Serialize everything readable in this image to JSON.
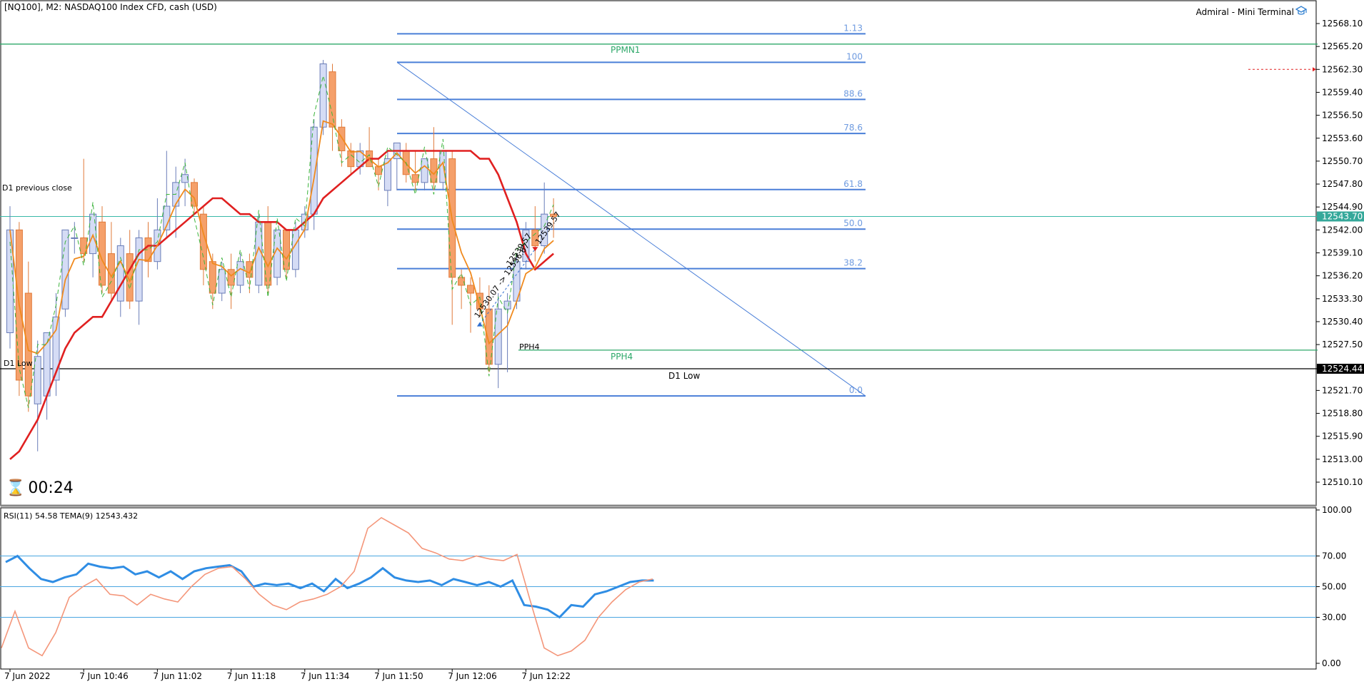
{
  "header": {
    "symbol_title": "[NQ100], M2:  NASDAQ100 Index CFD, cash (USD)",
    "terminal_label": "Admiral - Mini Terminal",
    "terminal_icon": "graduation-cap-icon"
  },
  "timer": {
    "icon": "hourglass-icon",
    "value": "00:24"
  },
  "colors": {
    "bull_fill": "#d5dcf5",
    "bull_border": "#6a7db8",
    "bear_fill": "#f5a06a",
    "bear_border": "#e07a3a",
    "fib_line": "#4a7fd8",
    "fib_text": "#6f9be0",
    "ppmn1": "#2ea86a",
    "pph4": "#2ea86a",
    "ma_red": "#e02020",
    "ma_orange": "#f08a1e",
    "ma_green_dashed": "#3cb43c",
    "bid_line": "#38b8a8",
    "bid_box": "#35a89a",
    "low_box": "#000000",
    "rsi_blue": "#2f8de4",
    "rsi_orange": "#f4967a",
    "rsi_level": "#4aa6e0",
    "grid_text": "#000000"
  },
  "chart_data": {
    "type": "candlestick",
    "price_axis": {
      "ylim": [
        12507.4,
        12570.0
      ],
      "ticks": [
        "12568.10",
        "12565.20",
        "12562.30",
        "12559.40",
        "12556.50",
        "12553.60",
        "12550.70",
        "12547.80",
        "12544.90",
        "12542.00",
        "12539.10",
        "12536.20",
        "12533.30",
        "12530.40",
        "12527.50",
        "12521.70",
        "12518.80",
        "12515.90",
        "12513.00",
        "12510.10"
      ],
      "tick_values": [
        12568.1,
        12565.2,
        12562.3,
        12559.4,
        12556.5,
        12553.6,
        12550.7,
        12547.8,
        12544.9,
        12542.0,
        12539.1,
        12536.2,
        12533.3,
        12530.4,
        12527.5,
        12521.7,
        12518.8,
        12515.9,
        12513.0,
        12510.1
      ],
      "current_price_label": "12543.70",
      "current_price": 12543.7,
      "low_price_label": "12524.44",
      "low_price": 12524.44
    },
    "time_axis": {
      "labels": [
        "7 Jun 2022",
        "7 Jun 10:46",
        "7 Jun 11:02",
        "7 Jun 11:18",
        "7 Jun 11:34",
        "7 Jun 11:50",
        "7 Jun 12:06",
        "7 Jun 12:22"
      ],
      "label_bar_index": [
        0,
        8,
        16,
        24,
        32,
        40,
        48,
        56
      ]
    },
    "candles": [
      {
        "o": 12529.0,
        "h": 12545.0,
        "l": 12527.0,
        "c": 12542.0
      },
      {
        "o": 12542.0,
        "h": 12543.0,
        "l": 12521.0,
        "c": 12523.0
      },
      {
        "o": 12534.0,
        "h": 12538.0,
        "l": 12519.0,
        "c": 12521.0
      },
      {
        "o": 12520.0,
        "h": 12528.0,
        "l": 12514.0,
        "c": 12526.0
      },
      {
        "o": 12521.0,
        "h": 12529.0,
        "l": 12518.0,
        "c": 12529.0
      },
      {
        "o": 12523.0,
        "h": 12534.0,
        "l": 12521.0,
        "c": 12531.0
      },
      {
        "o": 12532.0,
        "h": 12542.0,
        "l": 12531.0,
        "c": 12542.0
      },
      {
        "o": 12541.0,
        "h": 12543.0,
        "l": 12539.0,
        "c": 12541.0
      },
      {
        "o": 12541.0,
        "h": 12551.0,
        "l": 12538.0,
        "c": 12539.0
      },
      {
        "o": 12539.0,
        "h": 12544.0,
        "l": 12536.0,
        "c": 12544.0
      },
      {
        "o": 12543.0,
        "h": 12545.0,
        "l": 12534.0,
        "c": 12535.0
      },
      {
        "o": 12539.0,
        "h": 12543.0,
        "l": 12533.0,
        "c": 12534.0
      },
      {
        "o": 12533.0,
        "h": 12541.0,
        "l": 12531.0,
        "c": 12540.0
      },
      {
        "o": 12539.0,
        "h": 12542.0,
        "l": 12532.0,
        "c": 12533.0
      },
      {
        "o": 12533.0,
        "h": 12542.0,
        "l": 12530.0,
        "c": 12541.0
      },
      {
        "o": 12541.0,
        "h": 12543.0,
        "l": 12536.0,
        "c": 12538.0
      },
      {
        "o": 12538.0,
        "h": 12546.0,
        "l": 12537.0,
        "c": 12542.0
      },
      {
        "o": 12542.0,
        "h": 12552.0,
        "l": 12541.0,
        "c": 12545.0
      },
      {
        "o": 12545.0,
        "h": 12550.0,
        "l": 12541.0,
        "c": 12548.0
      },
      {
        "o": 12548.0,
        "h": 12551.0,
        "l": 12545.0,
        "c": 12549.0
      },
      {
        "o": 12548.0,
        "h": 12548.5,
        "l": 12544.0,
        "c": 12545.0
      },
      {
        "o": 12544.0,
        "h": 12545.0,
        "l": 12535.0,
        "c": 12537.0
      },
      {
        "o": 12538.0,
        "h": 12539.0,
        "l": 12532.0,
        "c": 12534.0
      },
      {
        "o": 12534.0,
        "h": 12538.0,
        "l": 12533.0,
        "c": 12537.0
      },
      {
        "o": 12537.0,
        "h": 12539.0,
        "l": 12532.0,
        "c": 12535.0
      },
      {
        "o": 12535.0,
        "h": 12539.0,
        "l": 12534.0,
        "c": 12538.0
      },
      {
        "o": 12538.0,
        "h": 12539.0,
        "l": 12534.0,
        "c": 12536.0
      },
      {
        "o": 12535.0,
        "h": 12544.0,
        "l": 12534.0,
        "c": 12543.0
      },
      {
        "o": 12543.0,
        "h": 12545.0,
        "l": 12534.0,
        "c": 12535.0
      },
      {
        "o": 12536.0,
        "h": 12542.0,
        "l": 12535.0,
        "c": 12542.0
      },
      {
        "o": 12542.0,
        "h": 12542.0,
        "l": 12536.0,
        "c": 12537.0
      },
      {
        "o": 12537.0,
        "h": 12543.0,
        "l": 12536.0,
        "c": 12542.0
      },
      {
        "o": 12542.0,
        "h": 12545.0,
        "l": 12541.0,
        "c": 12544.0
      },
      {
        "o": 12544.0,
        "h": 12556.0,
        "l": 12542.0,
        "c": 12555.0
      },
      {
        "o": 12555.0,
        "h": 12563.5,
        "l": 12554.0,
        "c": 12563.0
      },
      {
        "o": 12562.0,
        "h": 12563.0,
        "l": 12552.0,
        "c": 12555.0
      },
      {
        "o": 12555.0,
        "h": 12556.0,
        "l": 12550.0,
        "c": 12552.0
      },
      {
        "o": 12552.0,
        "h": 12553.0,
        "l": 12549.0,
        "c": 12550.0
      },
      {
        "o": 12550.0,
        "h": 12553.0,
        "l": 12549.0,
        "c": 12552.0
      },
      {
        "o": 12552.0,
        "h": 12555.0,
        "l": 12550.0,
        "c": 12550.0
      },
      {
        "o": 12550.0,
        "h": 12551.0,
        "l": 12547.0,
        "c": 12549.0
      },
      {
        "o": 12547.0,
        "h": 12552.0,
        "l": 12545.0,
        "c": 12551.0
      },
      {
        "o": 12551.0,
        "h": 12553.0,
        "l": 12547.0,
        "c": 12553.0
      },
      {
        "o": 12552.0,
        "h": 12553.0,
        "l": 12548.0,
        "c": 12549.0
      },
      {
        "o": 12549.0,
        "h": 12552.0,
        "l": 12547.0,
        "c": 12548.0
      },
      {
        "o": 12548.0,
        "h": 12551.0,
        "l": 12547.0,
        "c": 12551.0
      },
      {
        "o": 12551.0,
        "h": 12555.0,
        "l": 12547.0,
        "c": 12548.0
      },
      {
        "o": 12548.0,
        "h": 12552.0,
        "l": 12547.0,
        "c": 12552.0
      },
      {
        "o": 12551.0,
        "h": 12552.0,
        "l": 12530.0,
        "c": 12536.0
      },
      {
        "o": 12536.0,
        "h": 12537.0,
        "l": 12532.0,
        "c": 12535.0
      },
      {
        "o": 12535.0,
        "h": 12536.0,
        "l": 12529.0,
        "c": 12534.0
      },
      {
        "o": 12534.0,
        "h": 12536.0,
        "l": 12531.0,
        "c": 12532.0
      },
      {
        "o": 12532.0,
        "h": 12535.0,
        "l": 12524.0,
        "c": 12525.0
      },
      {
        "o": 12525.0,
        "h": 12534.0,
        "l": 12522.0,
        "c": 12532.0
      },
      {
        "o": 12532.0,
        "h": 12534.0,
        "l": 12524.0,
        "c": 12533.0
      },
      {
        "o": 12533.0,
        "h": 12539.0,
        "l": 12532.0,
        "c": 12538.0
      },
      {
        "o": 12538.0,
        "h": 12543.0,
        "l": 12537.0,
        "c": 12542.0
      },
      {
        "o": 12542.0,
        "h": 12545.0,
        "l": 12538.0,
        "c": 12540.0
      },
      {
        "o": 12540.0,
        "h": 12548.0,
        "l": 12539.0,
        "c": 12544.0
      },
      {
        "o": 12544.0,
        "h": 12546.0,
        "l": 12541.0,
        "c": 12543.7
      }
    ],
    "fibonacci": {
      "levels": [
        {
          "label": "1.13",
          "price": 12566.8
        },
        {
          "label": "100",
          "price": 12563.2
        },
        {
          "label": "88.6",
          "price": 12558.5
        },
        {
          "label": "78.6",
          "price": 12554.2
        },
        {
          "label": "61.8",
          "price": 12547.1
        },
        {
          "label": "50.0",
          "price": 12542.1
        },
        {
          "label": "38.2",
          "price": 12537.1
        },
        {
          "label": "0.0",
          "price": 12521.0
        }
      ]
    },
    "pivots": [
      {
        "label": "PPMN1",
        "price": 12565.5
      },
      {
        "label": "PPH4",
        "price": 12526.8
      }
    ],
    "annotations": {
      "d1_previous_close": "D1 previous close",
      "d1_low_left": "D1 Low",
      "d1_low_right": "D1 Low",
      "pph4_left": "PPH4",
      "trade_labels": [
        "12530.07 -> 12536.67",
        "12539.57",
        "12539.57"
      ]
    },
    "ma_red": [
      12513,
      12514,
      12516,
      12518,
      12521,
      12524,
      12527,
      12529,
      12530,
      12531,
      12531,
      12533,
      12535,
      12537,
      12539,
      12540,
      12540,
      12541,
      12542,
      12543,
      12544,
      12545,
      12546,
      12546,
      12545,
      12544,
      12544,
      12543,
      12543,
      12543,
      12542,
      12542,
      12543,
      12544,
      12546,
      12547,
      12548,
      12549,
      12550,
      12551,
      12551,
      12552,
      12552,
      12552,
      12552,
      12552,
      12552,
      12552,
      12552,
      12552,
      12552,
      12551,
      12551,
      12549,
      12546,
      12543,
      12539,
      12537,
      12538,
      12539
    ]
  },
  "rsi": {
    "title": "RSI(11) 54.58 TEMA(9) 12543.432",
    "ylim": [
      0,
      100
    ],
    "ticks": [
      "100.00",
      "70.00",
      "50.00",
      "30.00",
      "0.00"
    ],
    "tick_values": [
      100,
      70,
      50,
      30,
      0
    ],
    "levels": [
      70,
      50,
      30
    ],
    "rsi_values": [
      66,
      70,
      62,
      55,
      53,
      56,
      58,
      65,
      63,
      62,
      63,
      58,
      60,
      56,
      60,
      55,
      60,
      62,
      63,
      64,
      60,
      50,
      52,
      51,
      52,
      49,
      52,
      47,
      55,
      49,
      52,
      56,
      62,
      56,
      54,
      53,
      54,
      51,
      55,
      53,
      51,
      53,
      50,
      54,
      38,
      37,
      35,
      30,
      38,
      37,
      45,
      47,
      50,
      53,
      54,
      54
    ],
    "tema_values": [
      10,
      34,
      10,
      5,
      20,
      43,
      50,
      55,
      45,
      44,
      38,
      45,
      42,
      40,
      50,
      58,
      62,
      63,
      55,
      45,
      38,
      35,
      40,
      42,
      45,
      50,
      60,
      88,
      95,
      90,
      85,
      75,
      72,
      68,
      67,
      70,
      68,
      67,
      71,
      40,
      10,
      5,
      8,
      15,
      30,
      40,
      48,
      53,
      55
    ]
  }
}
